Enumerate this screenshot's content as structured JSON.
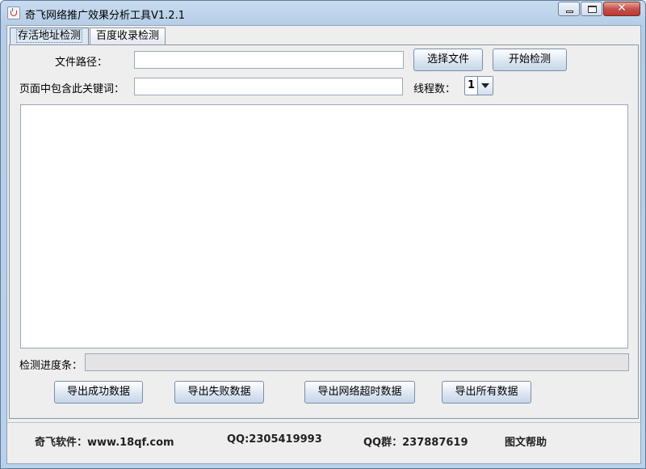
{
  "window": {
    "title": "奇飞网络推广效果分析工具V1.2.1"
  },
  "tabs": [
    {
      "label": "存活地址检测"
    },
    {
      "label": "百度收录检测"
    }
  ],
  "form": {
    "file_path_label": "文件路径：",
    "file_path_value": "",
    "select_file_label": "选择文件",
    "start_check_label": "开始检测",
    "keyword_label": "页面中包含此关键词：",
    "keyword_value": "",
    "threads_label": "线程数：",
    "threads_value": "1"
  },
  "progress": {
    "label": "检测进度条：",
    "value": 0
  },
  "export_buttons": {
    "success": "导出成功数据",
    "failed": "导出失败数据",
    "timeout": "导出网络超时数据",
    "all": "导出所有数据"
  },
  "footer": {
    "site": "奇飞软件：www.18qf.com",
    "qq": "QQ:2305419993",
    "qq_group": "QQ群：237887619",
    "help": "图文帮助"
  }
}
